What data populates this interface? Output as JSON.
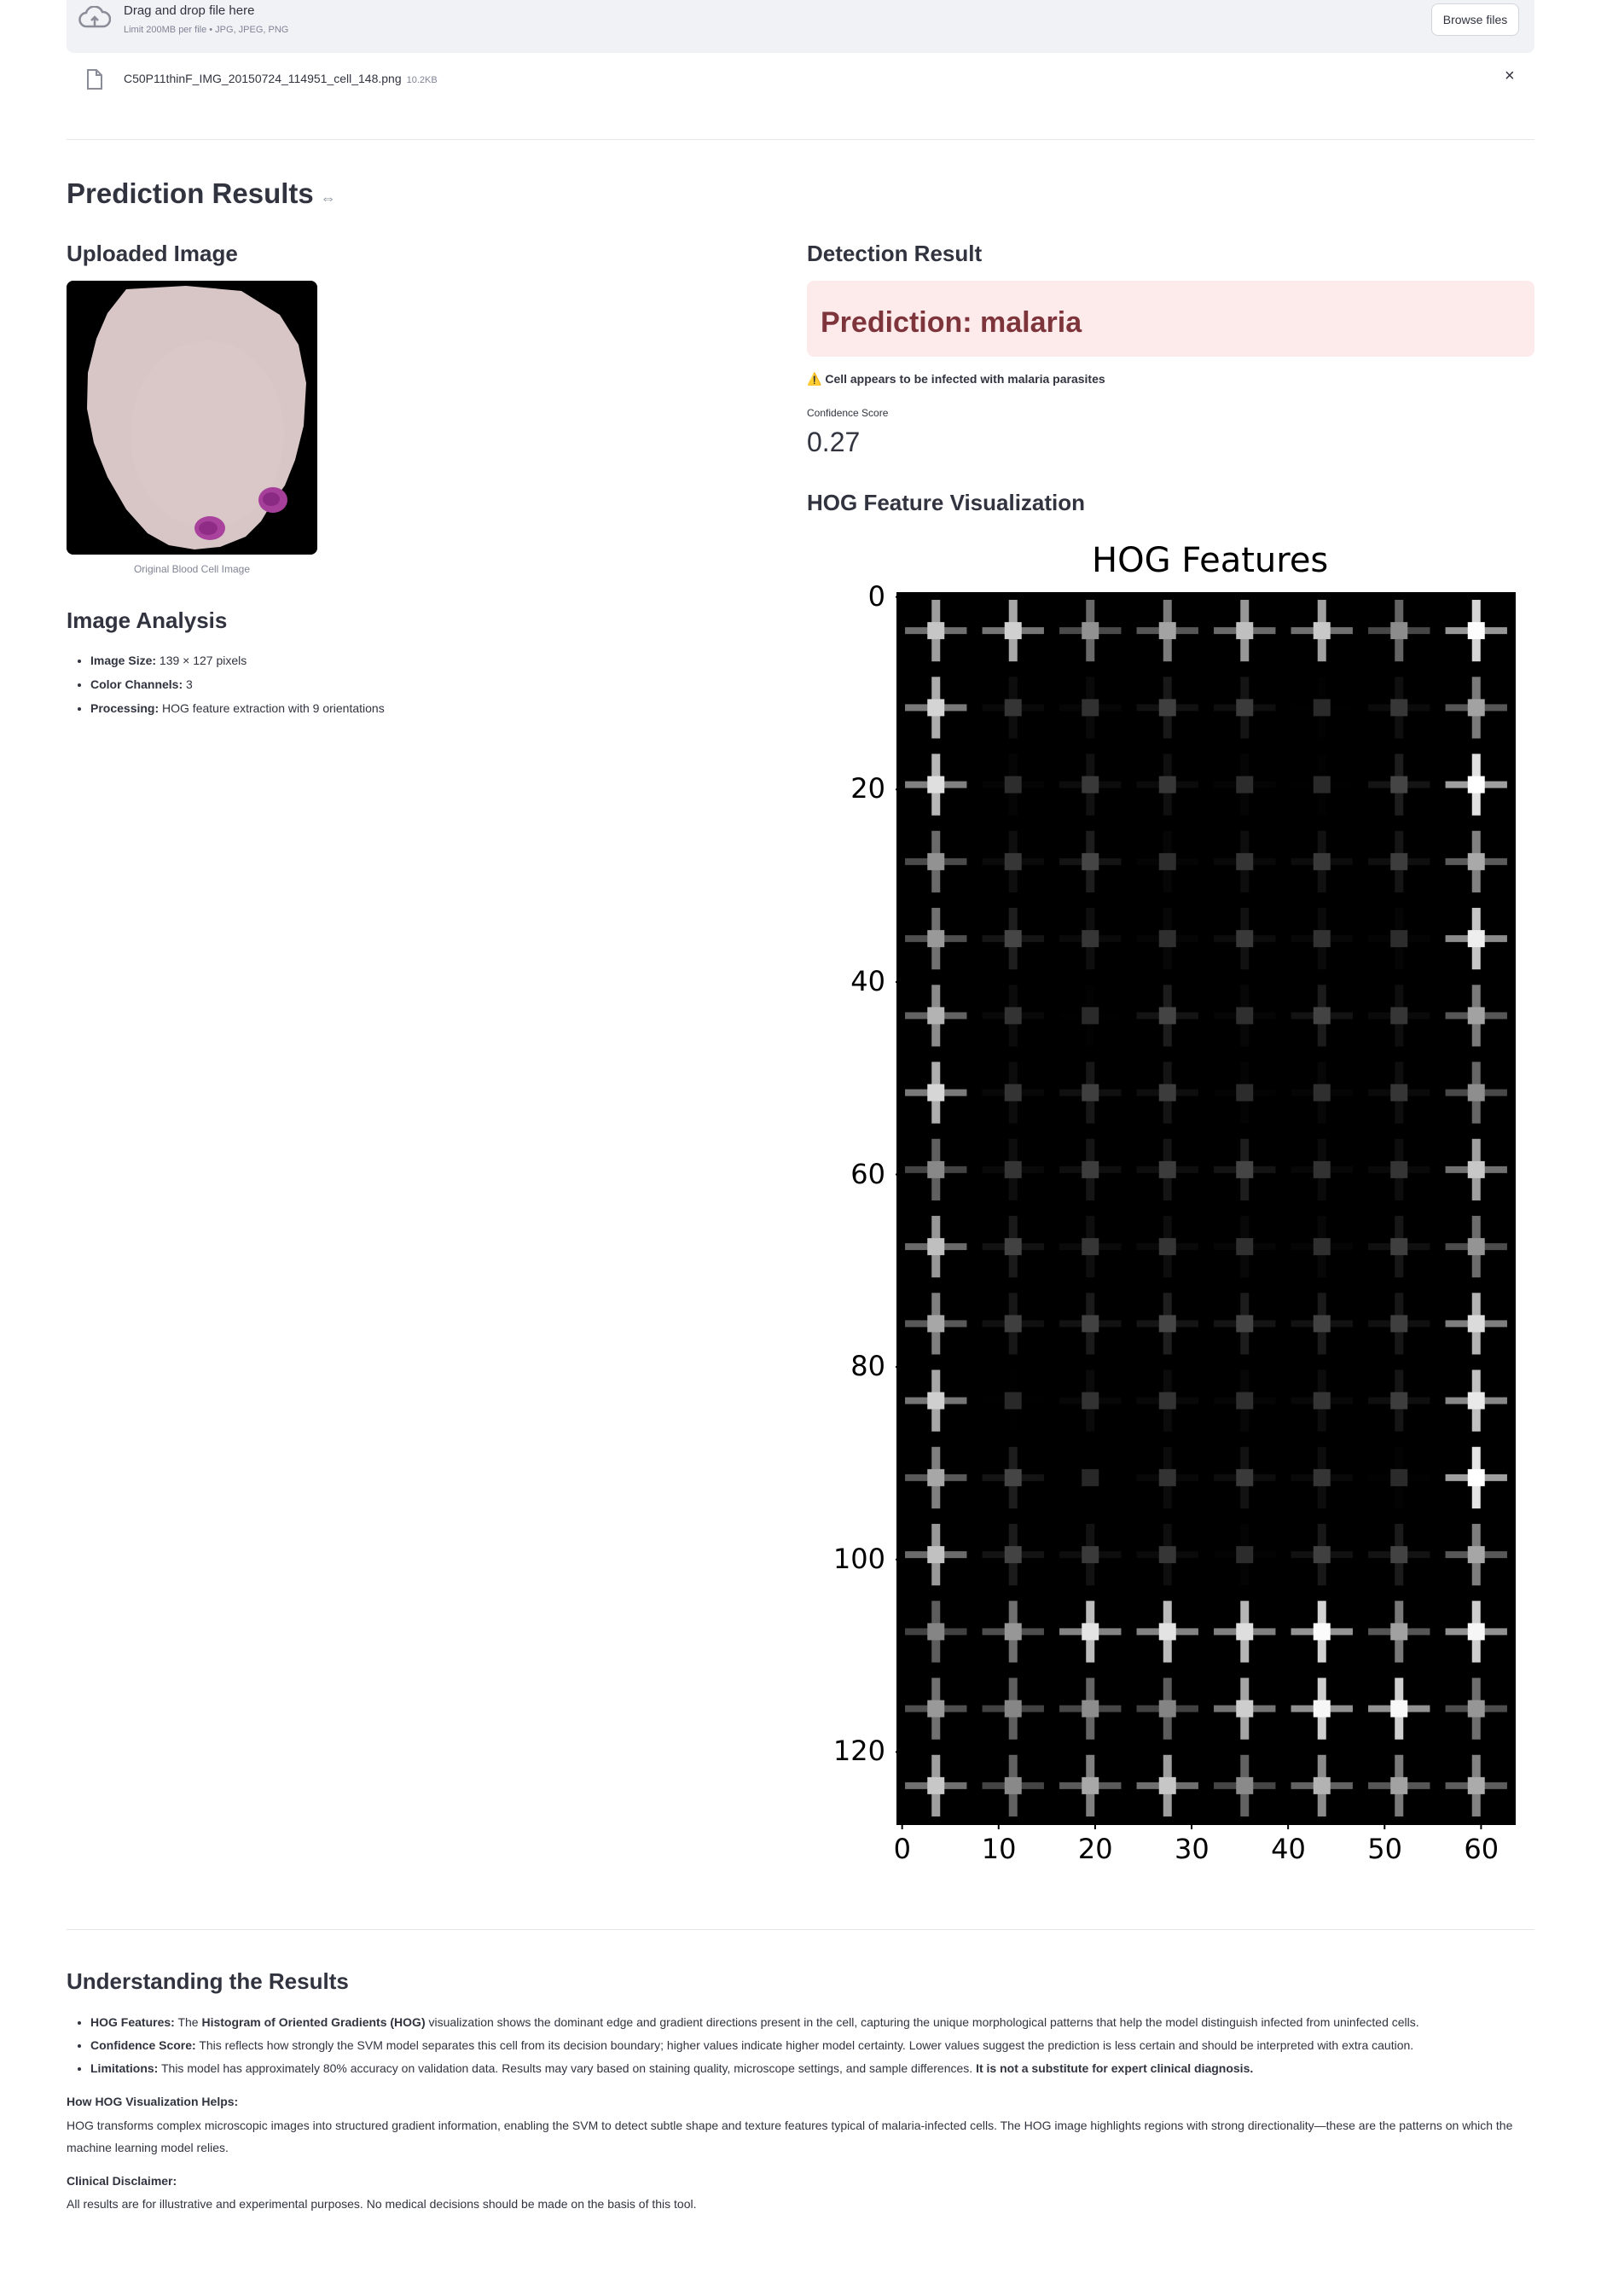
{
  "uploader": {
    "drag_text": "Drag and drop file here",
    "limit_text": "Limit 200MB per file • JPG, JPEG, PNG",
    "browse_label": "Browse files",
    "file_name": "C50P11thinF_IMG_20150724_114951_cell_148.png",
    "file_size": "10.2KB",
    "remove_symbol": "×"
  },
  "results": {
    "heading": "Prediction Results",
    "link_symbol": "⇔"
  },
  "uploaded": {
    "heading": "Uploaded Image",
    "caption": "Original Blood Cell Image"
  },
  "analysis": {
    "heading": "Image Analysis",
    "items": [
      {
        "label": "Image Size:",
        "value": "139 × 127 pixels"
      },
      {
        "label": "Color Channels:",
        "value": "3"
      },
      {
        "label": "Processing:",
        "value": "HOG feature extraction with 9 orientations"
      }
    ]
  },
  "detection": {
    "heading": "Detection Result",
    "prediction": "Prediction: malaria",
    "warning_icon": "⚠️",
    "warning_text": "Cell appears to be infected with malaria parasites",
    "confidence_label": "Confidence Score",
    "confidence_value": "0.27"
  },
  "hog": {
    "heading": "HOG Feature Visualization",
    "chart_title": "HOG Features"
  },
  "chart_data": {
    "type": "heatmap",
    "title": "HOG Features",
    "x_ticks": [
      "0",
      "10",
      "20",
      "30",
      "40",
      "50",
      "60"
    ],
    "y_ticks": [
      "0",
      "20",
      "40",
      "60",
      "80",
      "100",
      "120"
    ],
    "xlim": [
      0,
      63
    ],
    "ylim": [
      127,
      0
    ],
    "colormap": "gray",
    "image_size": "64 × 128",
    "cell_size": 8
  },
  "understanding": {
    "heading": "Understanding the Results",
    "items": [
      {
        "label": "HOG Features:",
        "pre": "The ",
        "bold": "Histogram of Oriented Gradients (HOG)",
        "post": " visualization shows the dominant edge and gradient directions present in the cell, capturing the unique morphological patterns that help the model distinguish infected from uninfected cells."
      },
      {
        "label": "Confidence Score:",
        "pre": "This reflects how strongly the SVM model separates this cell from its decision boundary; higher values indicate higher model certainty. Lower values suggest the prediction is less certain and should be interpreted with extra caution.",
        "bold": "",
        "post": ""
      },
      {
        "label": "Limitations:",
        "pre": "This model has approximately 80% accuracy on validation data. Results may vary based on staining quality, microscope settings, and sample differences. ",
        "bold": "It is not a substitute for expert clinical diagnosis.",
        "post": ""
      }
    ],
    "how_heading": "How HOG Visualization Helps:",
    "how_text": "HOG transforms complex microscopic images into structured gradient information, enabling the SVM to detect subtle shape and texture features typical of malaria-infected cells. The HOG image highlights regions with strong directionality—these are the patterns on which the machine learning model relies.",
    "disclaimer_heading": "Clinical Disclaimer:",
    "disclaimer_text": "All results are for illustrative and experimental purposes. No medical decisions should be made on the basis of this tool."
  }
}
